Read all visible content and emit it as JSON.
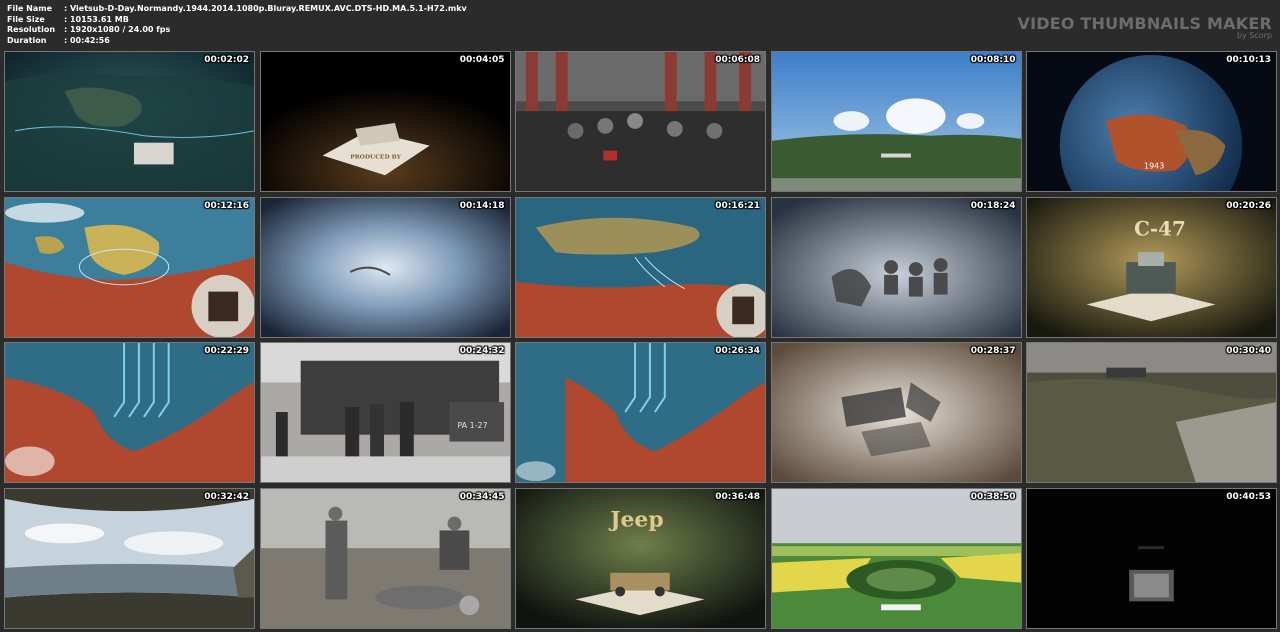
{
  "file_info": {
    "rows": [
      {
        "key": "File Name",
        "value": ":  Vietsub-D-Day.Normandy.1944.2014.1080p.Bluray.REMUX.AVC.DTS-HD.MA.5.1-H72.mkv"
      },
      {
        "key": "File Size",
        "value": ":  10153.61 MB"
      },
      {
        "key": "Resolution",
        "value": ":  1920x1080 / 24.00 fps"
      },
      {
        "key": "Duration",
        "value": ":  00:42:56"
      }
    ]
  },
  "brand": {
    "title": "VIDEO THUMBNAILS MAKER",
    "subtitle": "by Scorp"
  },
  "thumbnails": [
    {
      "time": "00:02:02",
      "scene": "map-europe-night"
    },
    {
      "time": "00:04:05",
      "scene": "book-credits",
      "text": "PRODUCED BY"
    },
    {
      "time": "00:06:08",
      "scene": "crowd-banners"
    },
    {
      "time": "00:08:10",
      "scene": "coast-sky"
    },
    {
      "time": "00:10:13",
      "scene": "globe-1943",
      "text": "1943"
    },
    {
      "time": "00:12:16",
      "scene": "map-england-red"
    },
    {
      "time": "00:14:18",
      "scene": "blue-vignette"
    },
    {
      "time": "00:16:21",
      "scene": "map-channel"
    },
    {
      "time": "00:18:24",
      "scene": "sketch-figures"
    },
    {
      "time": "00:20:26",
      "scene": "popup-c47",
      "text": "C-47"
    },
    {
      "time": "00:22:29",
      "scene": "map-arrows"
    },
    {
      "time": "00:24:32",
      "scene": "landing-craft",
      "text": "PA 1-27"
    },
    {
      "time": "00:26:34",
      "scene": "map-arrows-2"
    },
    {
      "time": "00:28:37",
      "scene": "sketch-logs"
    },
    {
      "time": "00:30:40",
      "scene": "aerial-battlefield"
    },
    {
      "time": "00:32:42",
      "scene": "panorama-beach"
    },
    {
      "time": "00:34:45",
      "scene": "field-people"
    },
    {
      "time": "00:36:48",
      "scene": "popup-jeep",
      "text": "Jeep"
    },
    {
      "time": "00:38:50",
      "scene": "aerial-fields"
    },
    {
      "time": "00:40:53",
      "scene": "black-frame"
    }
  ]
}
